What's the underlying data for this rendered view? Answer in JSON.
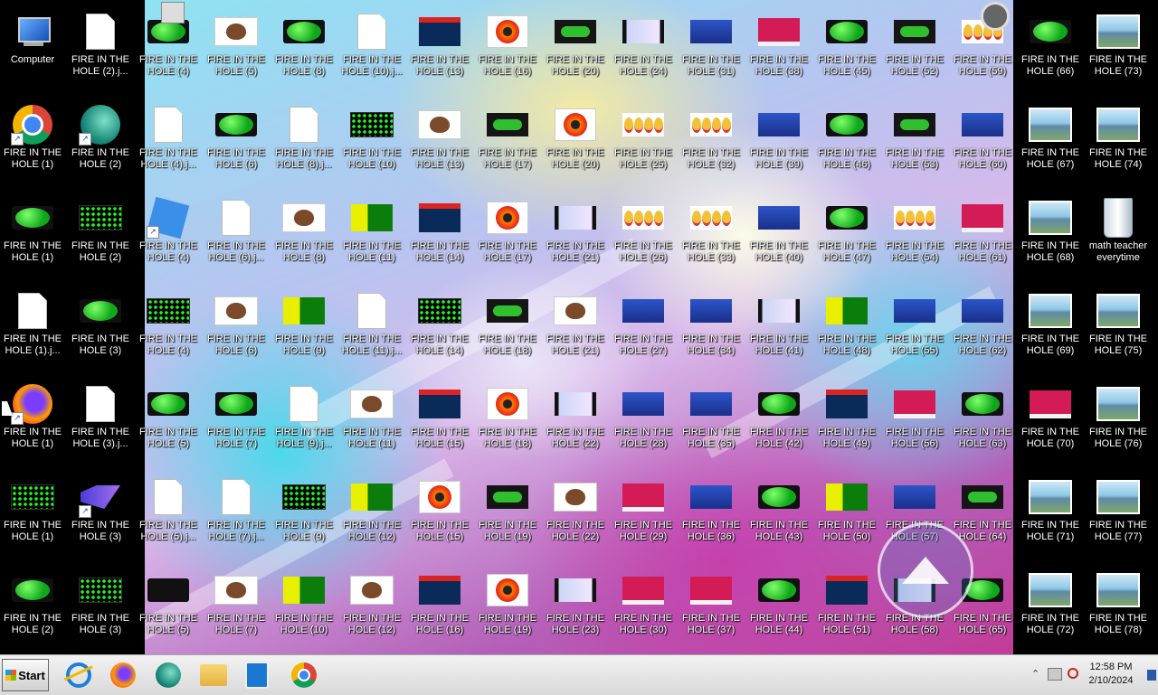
{
  "desktop": {
    "left_icons": [
      {
        "label": "Computer",
        "icon": "computer",
        "col": 0,
        "row": 0
      },
      {
        "label": "FIRE IN THE HOLE (2).j...",
        "icon": "doc",
        "col": 1,
        "row": 0
      },
      {
        "label": "FIRE IN THE HOLE (1)",
        "icon": "chrome",
        "shortcut": true,
        "col": 0,
        "row": 1
      },
      {
        "label": "FIRE IN THE HOLE (2)",
        "icon": "edge",
        "shortcut": true,
        "col": 1,
        "row": 1
      },
      {
        "label": "FIRE IN THE HOLE (1)",
        "icon": "green",
        "col": 0,
        "row": 2
      },
      {
        "label": "FIRE IN THE HOLE (2)",
        "icon": "dots",
        "col": 1,
        "row": 2
      },
      {
        "label": "FIRE IN THE HOLE (1).j...",
        "icon": "doc",
        "col": 0,
        "row": 3
      },
      {
        "label": "FIRE IN THE HOLE (3)",
        "icon": "green",
        "col": 1,
        "row": 3
      },
      {
        "label": "FIRE IN THE HOLE (1)",
        "icon": "firefox",
        "shortcut": true,
        "col": 0,
        "row": 4
      },
      {
        "label": "FIRE IN THE HOLE (3).j...",
        "icon": "doc",
        "col": 1,
        "row": 4
      },
      {
        "label": "FIRE IN THE HOLE (1)",
        "icon": "dots",
        "col": 0,
        "row": 5
      },
      {
        "label": "FIRE IN THE HOLE (3)",
        "icon": "vs",
        "shortcut": true,
        "col": 1,
        "row": 5
      },
      {
        "label": "FIRE IN THE HOLE (2)",
        "icon": "green",
        "col": 0,
        "row": 6
      },
      {
        "label": "FIRE IN THE HOLE (3)",
        "icon": "dots",
        "col": 1,
        "row": 6
      }
    ],
    "grid_columns": [
      {
        "col": 2,
        "items": [
          [
            "FIRE IN THE HOLE (4)",
            "green",
            "roblox"
          ],
          [
            "FIRE IN THE HOLE (4).j...",
            "doc"
          ],
          [
            "FIRE IN THE HOLE (4)",
            "roblox_blue"
          ],
          [
            "FIRE IN THE HOLE (4)",
            "dots"
          ],
          [
            "FIRE IN THE HOLE (5)",
            "green"
          ],
          [
            "FIRE IN THE HOLE (5).j...",
            "doc"
          ],
          [
            "FIRE IN THE HOLE (5)",
            "roblox"
          ]
        ]
      },
      {
        "col": 3,
        "items": [
          [
            "FIRE IN THE HOLE (5)",
            "hearts"
          ],
          [
            "FIRE IN THE HOLE (6)",
            "green"
          ],
          [
            "FIRE IN THE HOLE (6).j...",
            "doc"
          ],
          [
            "FIRE IN THE HOLE (6)",
            "hearts"
          ],
          [
            "FIRE IN THE HOLE (7)",
            "green"
          ],
          [
            "FIRE IN THE HOLE (7).j...",
            "doc"
          ],
          [
            "FIRE IN THE HOLE (7)",
            "hearts"
          ]
        ]
      },
      {
        "col": 4,
        "items": [
          [
            "FIRE IN THE HOLE (8)",
            "green"
          ],
          [
            "FIRE IN THE HOLE (8).j...",
            "doc"
          ],
          [
            "FIRE IN THE HOLE (8)",
            "hearts"
          ],
          [
            "FIRE IN THE HOLE (9)",
            "yellow"
          ],
          [
            "FIRE IN THE HOLE (9).j...",
            "doc"
          ],
          [
            "FIRE IN THE HOLE (9)",
            "dots"
          ],
          [
            "FIRE IN THE HOLE (10)",
            "yellow"
          ]
        ]
      },
      {
        "col": 5,
        "items": [
          [
            "FIRE IN THE HOLE (10).j...",
            "doc"
          ],
          [
            "FIRE IN THE HOLE (10)",
            "dots"
          ],
          [
            "FIRE IN THE HOLE (11)",
            "yellow"
          ],
          [
            "FIRE IN THE HOLE (11).j...",
            "doc"
          ],
          [
            "FIRE IN THE HOLE (11)",
            "hearts"
          ],
          [
            "FIRE IN THE HOLE (12)",
            "yellow"
          ],
          [
            "FIRE IN THE HOLE (12)",
            "hearts"
          ]
        ]
      },
      {
        "col": 6,
        "items": [
          [
            "FIRE IN THE HOLE (13)",
            "game"
          ],
          [
            "FIRE IN THE HOLE (13)",
            "hearts"
          ],
          [
            "FIRE IN THE HOLE (14)",
            "game"
          ],
          [
            "FIRE IN THE HOLE (14)",
            "dots"
          ],
          [
            "FIRE IN THE HOLE (15)",
            "game"
          ],
          [
            "FIRE IN THE HOLE (15)",
            "flower"
          ],
          [
            "FIRE IN THE HOLE (16)",
            "game"
          ]
        ]
      },
      {
        "col": 7,
        "items": [
          [
            "FIRE IN THE HOLE (16)",
            "flower"
          ],
          [
            "FIRE IN THE HOLE (17)",
            "tank"
          ],
          [
            "FIRE IN THE HOLE (17)",
            "flower"
          ],
          [
            "FIRE IN THE HOLE (18)",
            "tank"
          ],
          [
            "FIRE IN THE HOLE (18)",
            "flower"
          ],
          [
            "FIRE IN THE HOLE (19)",
            "tank"
          ],
          [
            "FIRE IN THE HOLE (19)",
            "flower"
          ]
        ]
      },
      {
        "col": 8,
        "items": [
          [
            "FIRE IN THE HOLE (20)",
            "tank"
          ],
          [
            "FIRE IN THE HOLE (20)",
            "flower"
          ],
          [
            "FIRE IN THE HOLE (21)",
            "anime"
          ],
          [
            "FIRE IN THE HOLE (21)",
            "hearts"
          ],
          [
            "FIRE IN THE HOLE (22)",
            "anime"
          ],
          [
            "FIRE IN THE HOLE (22)",
            "hearts"
          ],
          [
            "FIRE IN THE HOLE (23)",
            "anime"
          ]
        ]
      },
      {
        "col": 9,
        "items": [
          [
            "FIRE IN THE HOLE (24)",
            "anime"
          ],
          [
            "FIRE IN THE HOLE (25)",
            "faces"
          ],
          [
            "FIRE IN THE HOLE (26)",
            "faces"
          ],
          [
            "FIRE IN THE HOLE (27)",
            "blue"
          ],
          [
            "FIRE IN THE HOLE (28)",
            "blue"
          ],
          [
            "FIRE IN THE HOLE (29)",
            "pink"
          ],
          [
            "FIRE IN THE HOLE (30)",
            "pink"
          ]
        ]
      },
      {
        "col": 10,
        "items": [
          [
            "FIRE IN THE HOLE (31)",
            "blue"
          ],
          [
            "FIRE IN THE HOLE (32)",
            "faces"
          ],
          [
            "FIRE IN THE HOLE (33)",
            "faces"
          ],
          [
            "FIRE IN THE HOLE (34)",
            "blue"
          ],
          [
            "FIRE IN THE HOLE (35)",
            "blue"
          ],
          [
            "FIRE IN THE HOLE (36)",
            "blue"
          ],
          [
            "FIRE IN THE HOLE (37)",
            "pink"
          ]
        ]
      },
      {
        "col": 11,
        "items": [
          [
            "FIRE IN THE HOLE (38)",
            "pink"
          ],
          [
            "FIRE IN THE HOLE (39)",
            "blue"
          ],
          [
            "FIRE IN THE HOLE (40)",
            "blue"
          ],
          [
            "FIRE IN THE HOLE (41)",
            "anime"
          ],
          [
            "FIRE IN THE HOLE (42)",
            "green"
          ],
          [
            "FIRE IN THE HOLE (43)",
            "green"
          ],
          [
            "FIRE IN THE HOLE (44)",
            "green"
          ]
        ]
      },
      {
        "col": 12,
        "items": [
          [
            "FIRE IN THE HOLE (45)",
            "green"
          ],
          [
            "FIRE IN THE HOLE (46)",
            "green"
          ],
          [
            "FIRE IN THE HOLE (47)",
            "green"
          ],
          [
            "FIRE IN THE HOLE (48)",
            "yellow"
          ],
          [
            "FIRE IN THE HOLE (49)",
            "game"
          ],
          [
            "FIRE IN THE HOLE (50)",
            "yellow"
          ],
          [
            "FIRE IN THE HOLE (51)",
            "game"
          ]
        ]
      },
      {
        "col": 13,
        "items": [
          [
            "FIRE IN THE HOLE (52)",
            "tank"
          ],
          [
            "FIRE IN THE HOLE (53)",
            "tank"
          ],
          [
            "FIRE IN THE HOLE (54)",
            "faces"
          ],
          [
            "FIRE IN THE HOLE (55)",
            "blue"
          ],
          [
            "FIRE IN THE HOLE (56)",
            "pink"
          ],
          [
            "FIRE IN THE HOLE (57)",
            "blue"
          ],
          [
            "FIRE IN THE HOLE (58)",
            "anime"
          ]
        ]
      },
      {
        "col": 14,
        "items": [
          [
            "FIRE IN THE HOLE (59)",
            "faces",
            "gear"
          ],
          [
            "FIRE IN THE HOLE (60)",
            "blue"
          ],
          [
            "FIRE IN THE HOLE (61)",
            "pink"
          ],
          [
            "FIRE IN THE HOLE (62)",
            "blue"
          ],
          [
            "FIRE IN THE HOLE (63)",
            "green"
          ],
          [
            "FIRE IN THE HOLE (64)",
            "tank"
          ],
          [
            "FIRE IN THE HOLE (65)",
            "green"
          ]
        ]
      }
    ],
    "right_icons": [
      {
        "label": "FIRE IN THE HOLE (66)",
        "icon": "green",
        "col": 0,
        "row": 0
      },
      {
        "label": "FIRE IN THE HOLE (73)",
        "icon": "landscape",
        "col": 1,
        "row": 0
      },
      {
        "label": "FIRE IN THE HOLE (67)",
        "icon": "landscape",
        "col": 0,
        "row": 1
      },
      {
        "label": "FIRE IN THE HOLE (74)",
        "icon": "landscape",
        "col": 1,
        "row": 1
      },
      {
        "label": "FIRE IN THE HOLE (68)",
        "icon": "landscape",
        "col": 0,
        "row": 2
      },
      {
        "label": "math teacher everytime",
        "icon": "bin",
        "col": 1,
        "row": 2
      },
      {
        "label": "FIRE IN THE HOLE (69)",
        "icon": "landscape",
        "col": 0,
        "row": 3
      },
      {
        "label": "FIRE IN THE HOLE (75)",
        "icon": "landscape",
        "col": 1,
        "row": 3
      },
      {
        "label": "FIRE IN THE HOLE (70)",
        "icon": "pink",
        "col": 0,
        "row": 4
      },
      {
        "label": "FIRE IN THE HOLE (76)",
        "icon": "landscape",
        "col": 1,
        "row": 4
      },
      {
        "label": "FIRE IN THE HOLE (71)",
        "icon": "landscape",
        "col": 0,
        "row": 5
      },
      {
        "label": "FIRE IN THE HOLE (77)",
        "icon": "landscape",
        "col": 1,
        "row": 5
      },
      {
        "label": "FIRE IN THE HOLE (72)",
        "icon": "landscape",
        "col": 0,
        "row": 6
      },
      {
        "label": "FIRE IN THE HOLE (78)",
        "icon": "landscape",
        "col": 1,
        "row": 6
      }
    ]
  },
  "taskbar": {
    "start_label": "Start",
    "pinned": [
      {
        "name": "internet-explorer-icon",
        "cls": "tb-ie"
      },
      {
        "name": "firefox-icon",
        "cls": "tb-ff"
      },
      {
        "name": "edge-icon",
        "cls": "tb-edge"
      },
      {
        "name": "file-explorer-icon",
        "cls": "tb-folder"
      },
      {
        "name": "media-player-icon",
        "cls": "tb-media"
      },
      {
        "name": "chrome-icon",
        "cls": "tb-chrome"
      }
    ],
    "tray": {
      "chevron": "⌃",
      "time": "12:58 PM",
      "date": "2/10/2024"
    }
  },
  "colors": {
    "taskbar": "#e6e6e6",
    "desktop_black": "#000000",
    "label_text": "#ffffff"
  }
}
